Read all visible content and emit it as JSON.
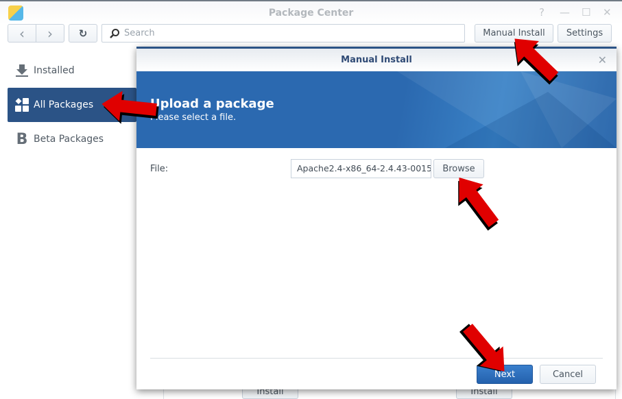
{
  "window": {
    "title": "Package Center",
    "controls": [
      "?",
      "—",
      "☐",
      "✕"
    ]
  },
  "toolbar": {
    "back": "‹",
    "forward": "›",
    "refresh": "↻",
    "search_placeholder": "Search",
    "manual_install": "Manual Install",
    "settings": "Settings"
  },
  "sidebar": {
    "items": [
      {
        "label": "Installed",
        "icon": "download-icon"
      },
      {
        "label": "All Packages",
        "icon": "grid-icon",
        "active": true
      },
      {
        "label": "Beta Packages",
        "icon": "beta-icon"
      }
    ]
  },
  "background": {
    "install_buttons": [
      "Install",
      "Install"
    ]
  },
  "dialog": {
    "title": "Manual Install",
    "close": "✕",
    "banner_title": "Upload a package",
    "banner_subtitle": "Please select a file.",
    "file_label": "File:",
    "file_value": "Apache2.4-x86_64-2.4.43-0015",
    "browse": "Browse",
    "next": "Next",
    "cancel": "Cancel"
  },
  "colors": {
    "accent": "#2b5386",
    "banner": "#2b69b0",
    "annotation_arrow": "#e00000"
  }
}
